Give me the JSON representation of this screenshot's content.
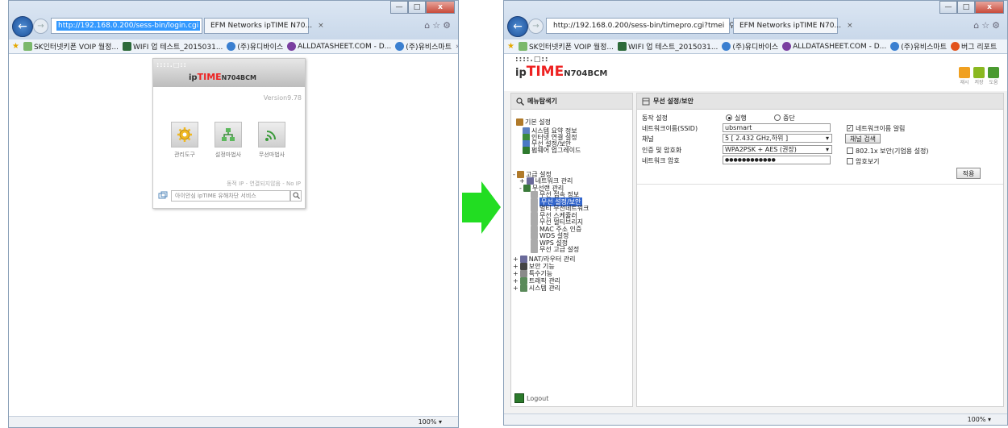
{
  "left_window": {
    "url": "http://192.168.0.200/sess-bin/login.cgi",
    "address_controls": "♀ ▾ ↻",
    "tab_title": "EFM Networks ipTIME N70...",
    "tab_close": "×",
    "window_buttons": {
      "min": "—",
      "max": "□",
      "close": "x"
    },
    "toolbar_icons": "⌂☆⚙",
    "favorites": [
      "SK인터넷키폰 VOIP 월정...",
      "WIFI 업 테스트_2015031...",
      "(주)유디바이스",
      "ALLDATASHEET.COM - D...",
      "(주)유비스마트"
    ],
    "fav_more": "»",
    "zoom": "100%  ▾",
    "login": {
      "dots": "::::.□::",
      "brand_ip": "ip",
      "brand_time": "TIME",
      "brand_model": "N704BCM",
      "version": "Version9.78",
      "buttons": [
        "관리도구",
        "설정마법사",
        "무선마법사"
      ],
      "status": "동적 IP - 연결되지않음 - No IP",
      "search_placeholder": "아이안심 ipTIME 유해차단 서비스"
    }
  },
  "right_window": {
    "url": "http://192.168.0.200/sess-bin/timepro.cgi?tmei",
    "address_controls": "♀ ▾ ↻",
    "tab_title": "EFM Networks ipTIME N70...",
    "tab_close": "×",
    "window_buttons": {
      "min": "—",
      "max": "□",
      "close": "x"
    },
    "toolbar_icons": "⌂☆⚙",
    "favorites": [
      "SK인터넷키폰 VOIP 월정...",
      "WIFI 업 테스트_2015031...",
      "(주)유디바이스",
      "ALLDATASHEET.COM - D...",
      "(주)유비스마트",
      "버그 리포트"
    ],
    "zoom": "100%  ▾",
    "header": {
      "dots": "::::.□::",
      "brand_ip": "ip",
      "brand_time": "TIME",
      "brand_model": "N704BCM",
      "icon_labels": [
        "재시",
        "저장",
        "도움"
      ]
    },
    "sidebar": {
      "title": "메뉴탐색기",
      "logout": "Logout"
    },
    "main": {
      "title": "무선 설정/보안",
      "mode_label": "동작 설정",
      "mode_on": "실행",
      "mode_off": "중단",
      "ssid_label": "네트워크이름(SSID)",
      "ssid_value": "ubsmart",
      "ssid_broadcast": "네트워크이름 알림",
      "channel_label": "채널",
      "channel_value": "5 [ 2.432 GHz,하위 ]",
      "channel_search": "채널 검색",
      "auth_label": "인증 및 암호화",
      "auth_value": "WPA2PSK + AES (권장)",
      "auth_8021x": "802.1x 보안(기업용 설정)",
      "pw_label": "네트워크 암호",
      "pw_value": "●●●●●●●●●●●●",
      "pw_show": "암호보기",
      "apply": "적용",
      "dropdown_glyph": "▾",
      "check_glyph": "✓"
    }
  },
  "tree_items": [
    {
      "label": "기본 설정",
      "color": "#b07a2a",
      "prefix": ""
    },
    {
      "label": "시스템 요약 정보",
      "color": "#5a7fc0",
      "prefix": ""
    },
    {
      "label": "인터넷 연결 설정",
      "color": "#3b8a3b",
      "prefix": ""
    },
    {
      "label": "무선 설정/보안",
      "color": "#4a78c4",
      "prefix": ""
    },
    {
      "label": "펌웨어 업그레이드",
      "color": "#2e7a2e",
      "prefix": ""
    },
    {
      "label": "고급 설정",
      "color": "#b07a2a",
      "prefix": "-"
    },
    {
      "label": "네트워크 관리",
      "color": "#6a6a9a",
      "prefix": "+"
    },
    {
      "label": "무선랜 관리",
      "color": "#3a7a3a",
      "prefix": "-"
    },
    {
      "label": "무선 접속 정보",
      "color": "#aaaaaa",
      "prefix": ""
    },
    {
      "label": "무선 설정/보안",
      "color": "#aaaaaa",
      "prefix": ""
    },
    {
      "label": "멀티 무선네트워크",
      "color": "#aaaaaa",
      "prefix": ""
    },
    {
      "label": "무선 스케쥴러",
      "color": "#aaaaaa",
      "prefix": ""
    },
    {
      "label": "무선 멀티브리지",
      "color": "#aaaaaa",
      "prefix": ""
    },
    {
      "label": "MAC 주소 인증",
      "color": "#aaaaaa",
      "prefix": ""
    },
    {
      "label": "WDS 설정",
      "color": "#aaaaaa",
      "prefix": ""
    },
    {
      "label": "WPS 설정",
      "color": "#aaaaaa",
      "prefix": ""
    },
    {
      "label": "무선 고급 설정",
      "color": "#aaaaaa",
      "prefix": ""
    },
    {
      "label": "NAT/라우터 관리",
      "color": "#6a6a9a",
      "prefix": "+"
    },
    {
      "label": "보안 기능",
      "color": "#444444",
      "prefix": "+"
    },
    {
      "label": "특수기능",
      "color": "#8a8a8a",
      "prefix": "+"
    },
    {
      "label": "트래픽 관리",
      "color": "#5a8a5a",
      "prefix": "+"
    },
    {
      "label": "시스템 관리",
      "color": "#5a8a5a",
      "prefix": "+"
    }
  ]
}
